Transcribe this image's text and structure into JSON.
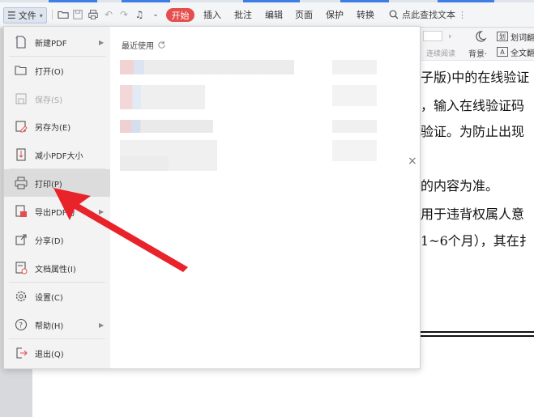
{
  "toolbar": {
    "file_label": "文件",
    "start_tab": "开始",
    "tabs": [
      "插入",
      "批注",
      "编辑",
      "页面",
      "保护",
      "转换"
    ],
    "search_text": "点此查找文本"
  },
  "right_panel": {
    "continuous_read": "连续阅读",
    "background_label": "背景·",
    "word_label": "划词翻",
    "fulltext_label": "全文翻"
  },
  "document": {
    "lines": [
      "子版)中的在线验证",
      "，输入在线验证码",
      "验证。为防止出现",
      "的内容为准。",
      "用于违背权属人意",
      "1~6个月），其在扌"
    ]
  },
  "file_menu": {
    "items": [
      {
        "label": "新建PDF",
        "icon": "new-pdf-icon",
        "has_submenu": true
      },
      {
        "label": "打开(O)",
        "icon": "folder-open-icon",
        "has_submenu": false
      },
      {
        "label": "保存(S)",
        "icon": "save-icon",
        "has_submenu": false,
        "disabled": true
      },
      {
        "label": "另存为(E)",
        "icon": "save-as-icon",
        "has_submenu": false
      },
      {
        "label": "减小PDF大小",
        "icon": "compress-icon",
        "has_submenu": false
      },
      {
        "label": "打印(P)",
        "icon": "printer-icon",
        "has_submenu": false,
        "selected": true
      },
      {
        "label": "导出PDF为",
        "icon": "export-pdf-icon",
        "has_submenu": true
      },
      {
        "label": "分享(D)",
        "icon": "share-icon",
        "has_submenu": false
      },
      {
        "label": "文档属性(I)",
        "icon": "properties-icon",
        "has_submenu": false
      },
      {
        "label": "设置(C)",
        "icon": "gear-icon",
        "has_submenu": false
      },
      {
        "label": "帮助(H)",
        "icon": "help-icon",
        "has_submenu": true
      },
      {
        "label": "退出(Q)",
        "icon": "exit-icon",
        "has_submenu": false
      }
    ],
    "recent_title": "最近使用"
  },
  "colors": {
    "accent_red": "#e64d4d",
    "annotation_arrow": "#e8232a",
    "menu_selected": "#dcdcdc"
  }
}
